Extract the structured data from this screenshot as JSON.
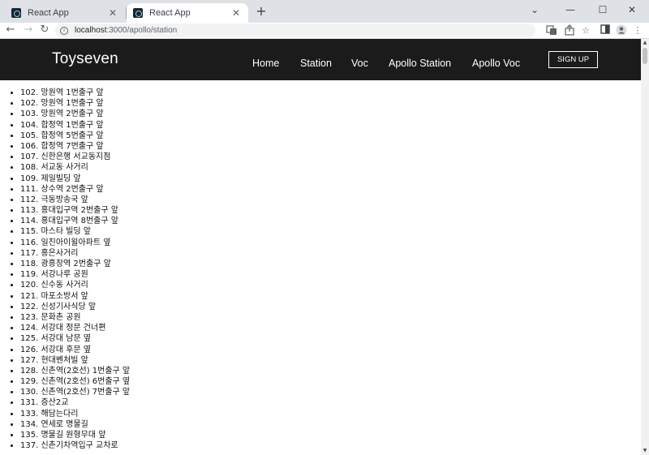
{
  "browser": {
    "tabs": [
      {
        "title": "React App",
        "close": "✕"
      },
      {
        "title": "React App",
        "close": "✕"
      }
    ],
    "new_tab": "+",
    "window_controls": {
      "dropdown": "⌄",
      "minimize": "—",
      "maximize": "☐",
      "close": "✕"
    },
    "url_host": "localhost",
    "url_path": ":3000/apollo/station",
    "toolbar_icons": [
      "translate-icon",
      "share-icon",
      "star-icon",
      "sidebar-icon",
      "profile-icon",
      "menu-icon"
    ]
  },
  "header": {
    "brand": "Toyseven",
    "nav": [
      {
        "label": "Home"
      },
      {
        "label": "Station"
      },
      {
        "label": "Voc"
      },
      {
        "label": "Apollo Station"
      },
      {
        "label": "Apollo Voc"
      }
    ],
    "signup_label": "SIGN UP",
    "background": "#1c1b1b"
  },
  "stations": [
    "102. 망원역 1번출구 앞",
    "102. 망원역 1번출구 앞",
    "103. 망원역 2번출구 앞",
    "104. 합정역 1번출구 앞",
    "105. 합정역 5번출구 앞",
    "106. 합정역 7번출구 앞",
    "107. 신한은행 서교동지점",
    "108. 서교동 사거리",
    "109. 제일빌딩 앞",
    "111. 상수역 2번출구 앞",
    "112. 극동방송국 앞",
    "113. 홍대입구역 2번출구 앞",
    "114. 홍대입구역 8번출구 앞",
    "115. 마스타 빌딩 앞",
    "116. 일진아이윌아파트 옆",
    "117. 홍은사거리",
    "118. 광흥창역 2번출구 앞",
    "119. 서강나루 공원",
    "120. 신수동 사거리",
    "121. 마포소방서 앞",
    "122. 신성기사식당 앞",
    "123. 문화촌 공원",
    "124. 서강대 정문 건너편",
    "125. 서강대 남문 옆",
    "126. 서강대 후문 옆",
    "127. 현대벤처빌 앞",
    "128. 신촌역(2호선) 1번출구 앞",
    "129. 신촌역(2호선) 6번출구 옆",
    "130. 신촌역(2호선) 7번출구 앞",
    "131. 증산2교",
    "133. 해담는다리",
    "134. 연세로 명물길",
    "135. 명물길 원형무대 앞",
    "137. 신촌기차역입구 교차로"
  ]
}
